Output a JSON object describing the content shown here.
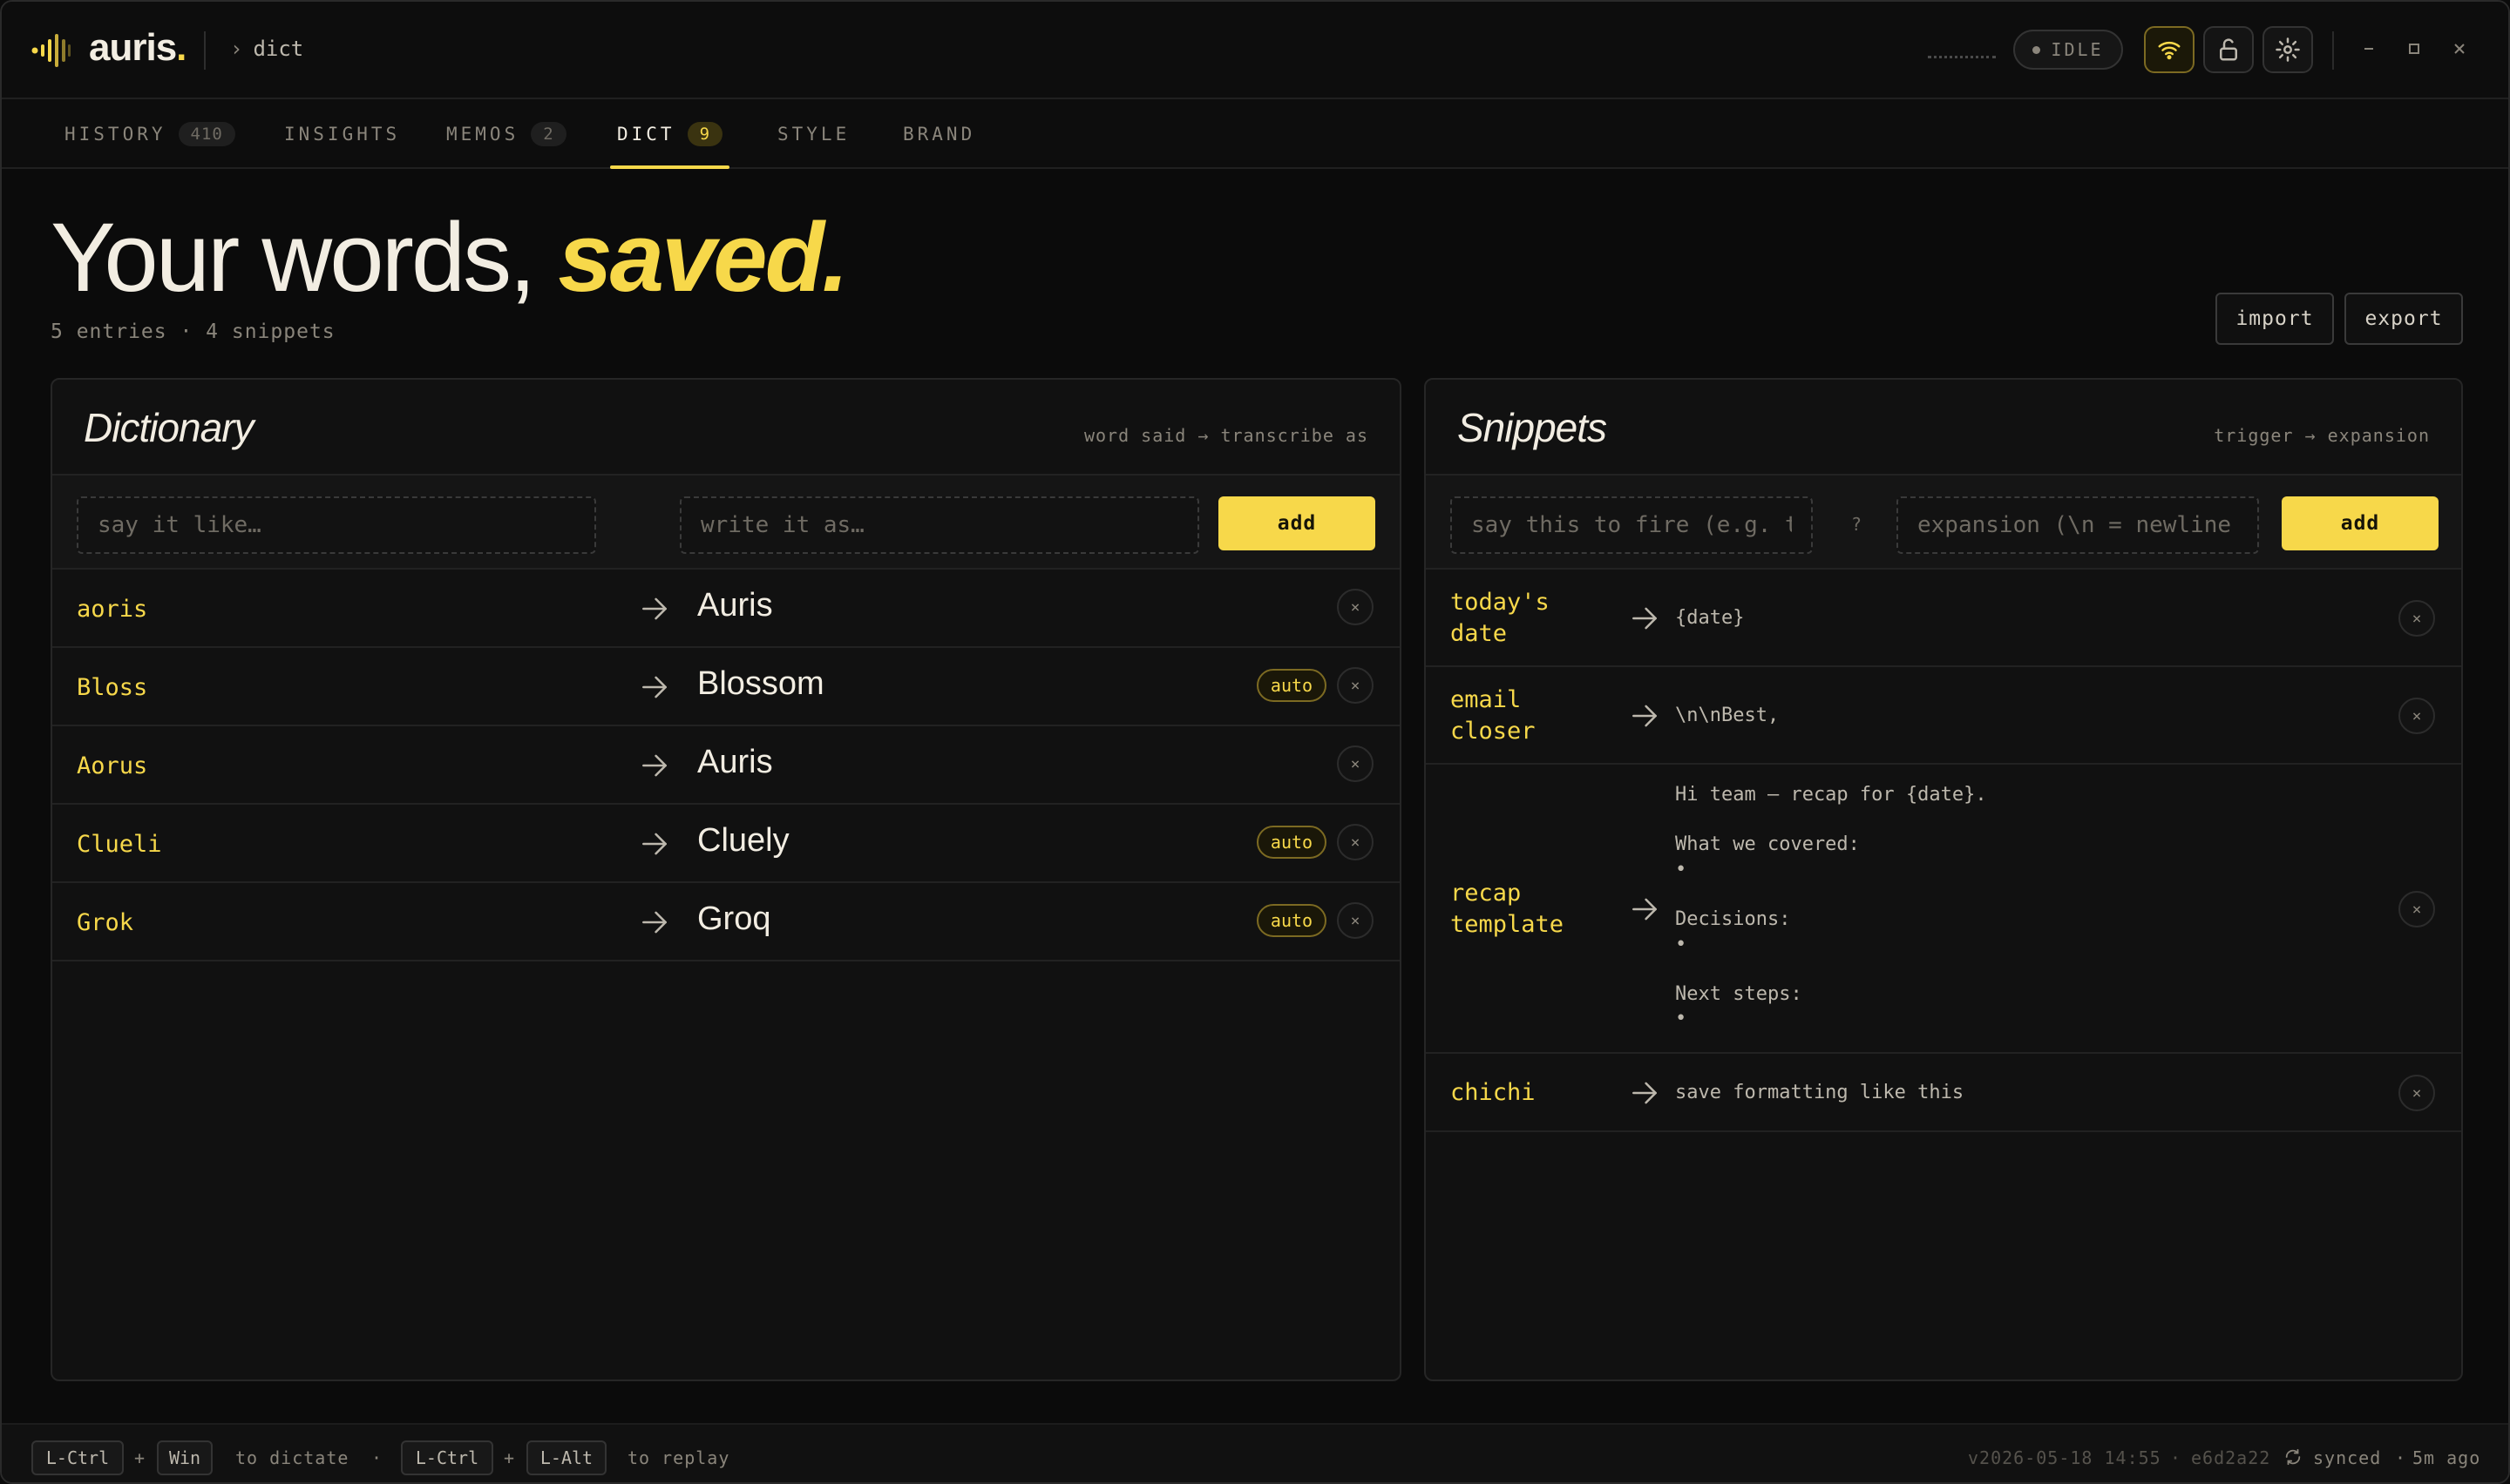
{
  "app": {
    "name": "auris",
    "name_dot": ".",
    "breadcrumb_chevron": "›",
    "breadcrumb": "dict",
    "status": "IDLE",
    "icons": [
      "wifi-icon",
      "unlock-icon",
      "gear-icon",
      "minimize-icon",
      "maximize-icon",
      "close-icon"
    ]
  },
  "tabs": [
    {
      "label": "HISTORY",
      "count": "410"
    },
    {
      "label": "INSIGHTS",
      "count": ""
    },
    {
      "label": "MEMOS",
      "count": "2"
    },
    {
      "label": "DICT",
      "count": "9"
    },
    {
      "label": "STYLE",
      "count": ""
    },
    {
      "label": "BRAND",
      "count": ""
    }
  ],
  "active_tab": "DICT",
  "hero": {
    "title": "Your words,",
    "title_accent": "saved.",
    "subtitle": "5 entries · 4 snippets",
    "import_label": "import",
    "export_label": "export"
  },
  "dictionary": {
    "title": "Dictionary",
    "hint": "word said → transcribe as",
    "say_placeholder": "say it like…",
    "write_placeholder": "write it as…",
    "add_label": "add",
    "auto_label": "auto",
    "remove_glyph": "×",
    "entries": [
      {
        "said": "aoris",
        "write": "Auris",
        "auto": false
      },
      {
        "said": "Bloss",
        "write": "Blossom",
        "auto": true
      },
      {
        "said": "Aorus",
        "write": "Auris",
        "auto": false
      },
      {
        "said": "Clueli",
        "write": "Cluely",
        "auto": true
      },
      {
        "said": "Grok",
        "write": "Groq",
        "auto": true
      }
    ]
  },
  "snippets": {
    "title": "Snippets",
    "hint": "trigger → expansion",
    "trigger_placeholder": "say this to fire (e.g. t",
    "help_glyph": "?",
    "expansion_placeholder": "expansion (\\n = newline",
    "add_label": "add",
    "remove_glyph": "×",
    "entries": [
      {
        "trigger": "today's\ndate",
        "expansion": "{date}"
      },
      {
        "trigger": "email\ncloser",
        "expansion": "\\n\\nBest,"
      },
      {
        "trigger": "recap\ntemplate",
        "expansion": "Hi team — recap for {date}.\n\nWhat we covered:\n•\n\nDecisions:\n•\n\nNext steps:\n•"
      },
      {
        "trigger": "chichi",
        "expansion": "save formatting like this"
      }
    ]
  },
  "footer": {
    "key1": "L-Ctrl",
    "plus1": "+",
    "key2": "Win",
    "action1": "to dictate",
    "sep": "·",
    "key3": "L-Ctrl",
    "plus2": "+",
    "key4": "L-Alt",
    "action2": "to replay",
    "version": "v2026-05-18 14:55",
    "dot1": "·",
    "hash": "e6d2a22",
    "sync": "synced",
    "dot2": "·",
    "ago": "5m ago"
  },
  "colors": {
    "accent": "#f7d84a",
    "background": "#0b0b0b",
    "panel": "#111111",
    "text": "#f2ede2",
    "muted": "#8a857b"
  }
}
